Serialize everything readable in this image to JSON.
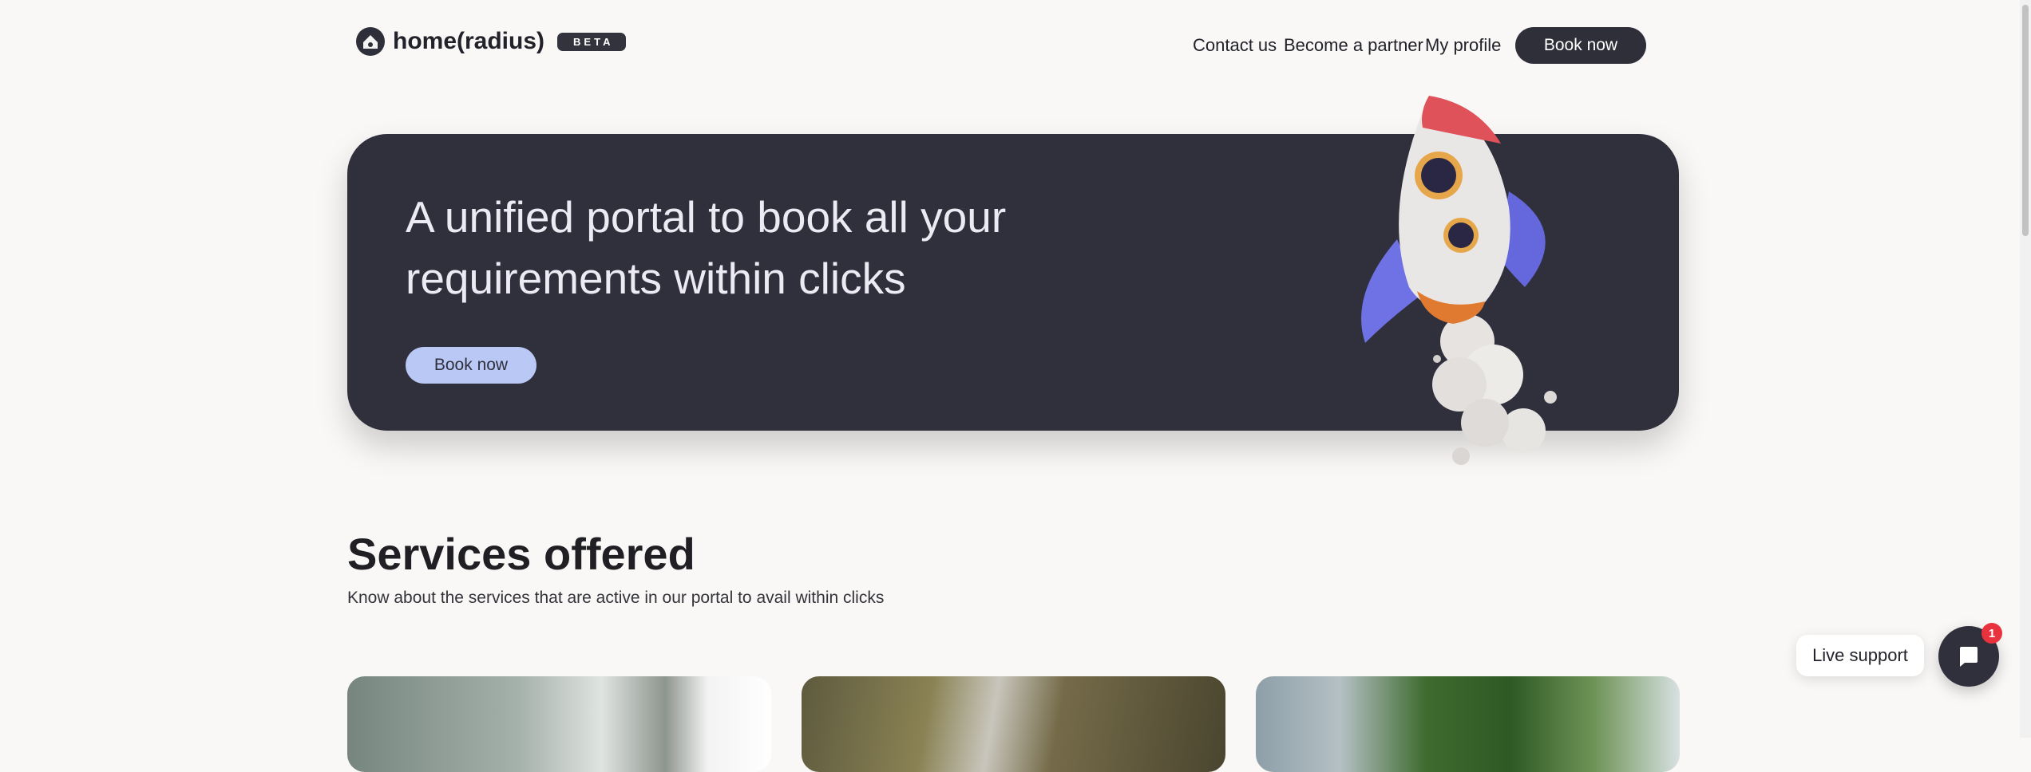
{
  "header": {
    "logo_text": "home(radius)",
    "beta_label": "BETA",
    "nav": {
      "contact": "Contact us",
      "partner": "Become a partner",
      "profile": "My profile",
      "book": "Book now"
    }
  },
  "hero": {
    "title": "A unified portal to book all your requirements within clicks",
    "button": "Book now"
  },
  "services": {
    "title": "Services offered",
    "subtitle": "Know about the services that are active in our portal to avail within clicks"
  },
  "support": {
    "label": "Live support",
    "badge_count": "1"
  },
  "colors": {
    "background": "#faf8f6",
    "hero_bg": "#30303c",
    "hero_button": "#b9c8f5",
    "dark_button": "#2f2f3a",
    "badge": "#e8333f"
  }
}
